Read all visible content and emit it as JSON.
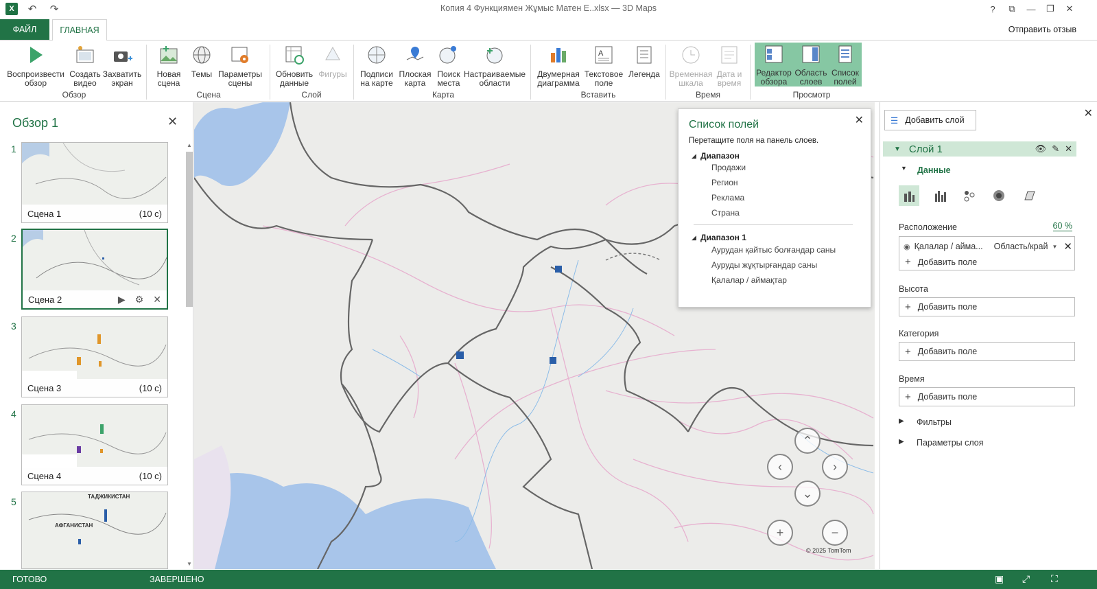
{
  "window": {
    "title": "Копия 4 Функциямен Жұмыс Матен Е..xlsx — 3D Maps",
    "app_icon": "X",
    "buttons": [
      "?",
      "⧉",
      "—",
      "❐",
      "✕"
    ]
  },
  "tabs": {
    "file": "ФАЙЛ",
    "home": "ГЛАВНАЯ",
    "feedback": "Отправить отзыв"
  },
  "ribbon": {
    "play_tour": "Воспроизвести обзор",
    "create_video": "Создать видео",
    "capture_screen": "Захватить экран",
    "new_scene": "Новая сцена",
    "themes": "Темы",
    "scene_options": "Параметры сцены",
    "refresh_data": "Обновить данные",
    "shapes": "Фигуры",
    "map_labels": "Подписи на карте",
    "flat_map": "Плоская карта",
    "find_location": "Поиск места",
    "custom_regions": "Настраиваемые области",
    "two_d_chart": "Двумерная диаграмма",
    "text_box": "Текстовое поле",
    "legend": "Легенда",
    "timeline": "Временная шкала",
    "date_time": "Дата и время",
    "tour_editor": "Редактор обзора",
    "layer_pane": "Область слоев",
    "field_list": "Список полей",
    "groups": {
      "tour": "Обзор",
      "scene": "Сцена",
      "layer": "Слой",
      "map": "Карта",
      "insert": "Вставить",
      "time": "Время",
      "view": "Просмотр"
    }
  },
  "tour": {
    "title": "Обзор 1",
    "scenes": [
      {
        "num": "1",
        "label": "Сцена 1",
        "duration": "(10 с)"
      },
      {
        "num": "2",
        "label": "Сцена 2",
        "duration": ""
      },
      {
        "num": "3",
        "label": "Сцена 3",
        "duration": "(10 с)"
      },
      {
        "num": "4",
        "label": "Сцена 4",
        "duration": "(10 с)"
      },
      {
        "num": "5",
        "label": "",
        "duration": ""
      }
    ],
    "thumb5_labels": [
      "ТАДЖИКИСТАН",
      "АФГАНИСТАН"
    ]
  },
  "field_list": {
    "title": "Список полей",
    "subtitle": "Перетащите поля на панель слоев.",
    "groups": [
      {
        "name": "Диапазон",
        "fields": [
          "Продажи",
          "Регион",
          "Реклама",
          "Страна"
        ]
      },
      {
        "name": "Диапазон 1",
        "fields": [
          "Аурудан қайтыс болғандар саны",
          "Ауруды жұқтырғандар саны",
          "Қалалар / аймақтар"
        ]
      }
    ]
  },
  "map": {
    "copyright": "© 2025 TomTom"
  },
  "layer_pane": {
    "add_layer": "Добавить слой",
    "layer_name": "Слой 1",
    "data_header": "Данные",
    "location_label": "Расположение",
    "location_percent": "60 %",
    "location_field": "Қалалар / айма...",
    "location_type": "Область/край",
    "add_field": "Добавить поле",
    "height_label": "Высота",
    "category_label": "Категория",
    "time_label": "Время",
    "filters": "Фильтры",
    "layer_options": "Параметры слоя"
  },
  "status": {
    "ready": "ГОТОВО",
    "done": "ЗАВЕРШЕНО"
  },
  "colors": {
    "accent": "#217346",
    "selected_bg": "#86c7a3",
    "marker": "#2a5ea8"
  }
}
